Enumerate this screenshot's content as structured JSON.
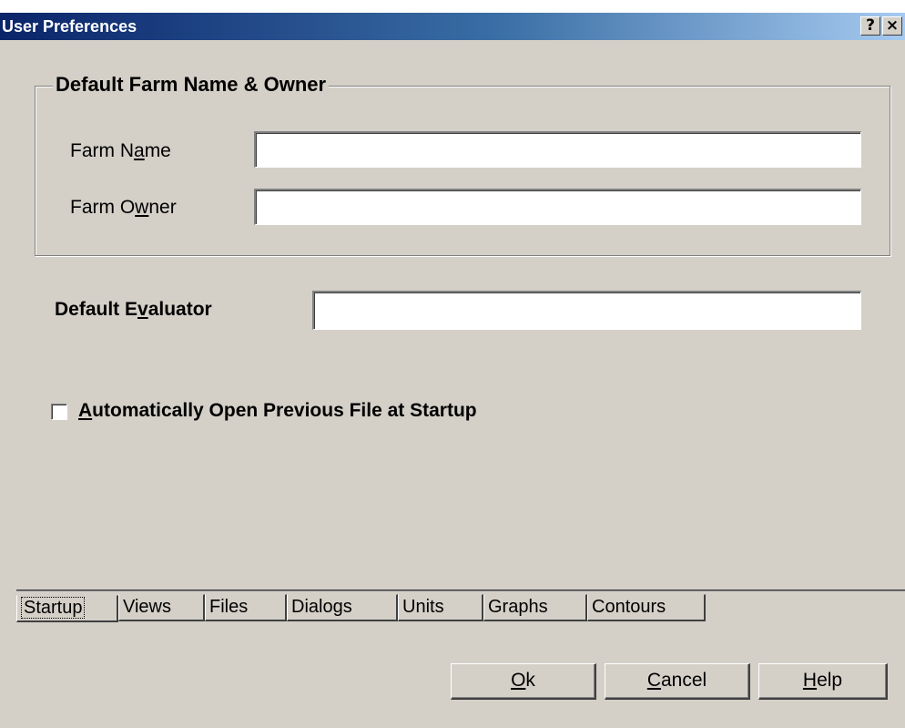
{
  "window": {
    "title": "User Preferences",
    "help_button": "?",
    "close_button": "×"
  },
  "farm_group": {
    "legend": "Default Farm Name & Owner",
    "farm_name_label_pre": "Farm N",
    "farm_name_label_ul": "a",
    "farm_name_label_post": "me",
    "farm_name_value": "",
    "farm_owner_label_pre": "Farm O",
    "farm_owner_label_ul": "w",
    "farm_owner_label_post": "ner",
    "farm_owner_value": ""
  },
  "evaluator": {
    "label_pre": "Default E",
    "label_ul": "v",
    "label_post": "aluator",
    "value": ""
  },
  "auto_open": {
    "label_ul": "A",
    "label_post": "utomatically Open Previous File at Startup",
    "checked": false
  },
  "tabs": [
    {
      "label": "Startup",
      "active": true
    },
    {
      "label": "Views",
      "active": false
    },
    {
      "label": "Files",
      "active": false
    },
    {
      "label": "Dialogs",
      "active": false
    },
    {
      "label": "Units",
      "active": false
    },
    {
      "label": "Graphs",
      "active": false
    },
    {
      "label": "Contours",
      "active": false
    }
  ],
  "buttons": {
    "ok_ul": "O",
    "ok_post": "k",
    "cancel_ul": "C",
    "cancel_post": "ancel",
    "help_ul": "H",
    "help_post": "elp"
  }
}
